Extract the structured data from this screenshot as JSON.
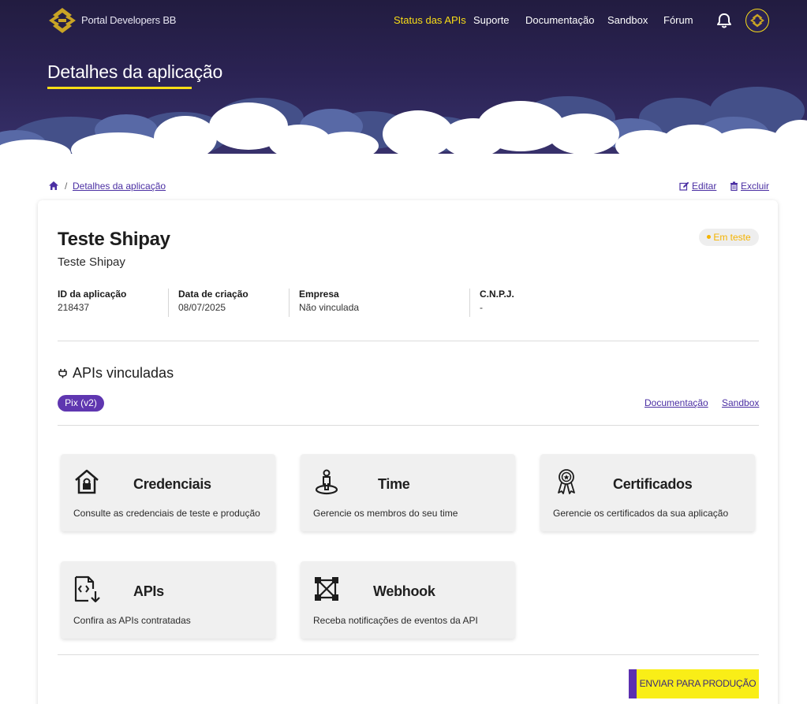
{
  "header": {
    "brand": "Portal Developers BB",
    "nav": [
      {
        "label": "Status das APIs",
        "active": true
      },
      {
        "label": "Suporte",
        "active": false
      },
      {
        "label": "Documentação",
        "active": false
      },
      {
        "label": "Sandbox",
        "active": false
      },
      {
        "label": "Fórum",
        "active": false
      }
    ],
    "page_title": "Detalhes da aplicação",
    "accent_color": "#f9dd16"
  },
  "breadcrumb": {
    "current": "Detalhes da aplicação",
    "separator": "/",
    "actions": {
      "edit": "Editar",
      "delete": "Excluir"
    }
  },
  "app": {
    "name": "Teste Shipay",
    "description": "Teste Shipay",
    "status": "Em teste",
    "info": [
      {
        "label": "ID da aplicação",
        "value": "218437"
      },
      {
        "label": "Data de criação",
        "value": "08/07/2025"
      },
      {
        "label": "Empresa",
        "value": "Não vinculada"
      },
      {
        "label": "C.N.P.J.",
        "value": "-"
      }
    ]
  },
  "apis": {
    "title": "APIs vinculadas",
    "tag": "Pix (v2)",
    "links": {
      "documentation": "Documentação",
      "sandbox": "Sandbox"
    }
  },
  "tiles": [
    {
      "title": "Credenciais",
      "description": "Consulte as credenciais de teste e produção",
      "icon": "house-lock-icon"
    },
    {
      "title": "Time",
      "description": "Gerencie os membros do seu time",
      "icon": "person-pin-icon"
    },
    {
      "title": "Certificados",
      "description": "Gerencie os certificados da sua aplicação",
      "icon": "award-ribbon-icon"
    },
    {
      "title": "APIs",
      "description": "Confira as APIs contratadas",
      "icon": "code-file-download-icon"
    },
    {
      "title": "Webhook",
      "description": "Receba notificações de eventos da API",
      "icon": "webhook-nodes-icon"
    }
  ],
  "footer": {
    "submit_label": "ENVIAR PARA PRODUÇÃO"
  }
}
